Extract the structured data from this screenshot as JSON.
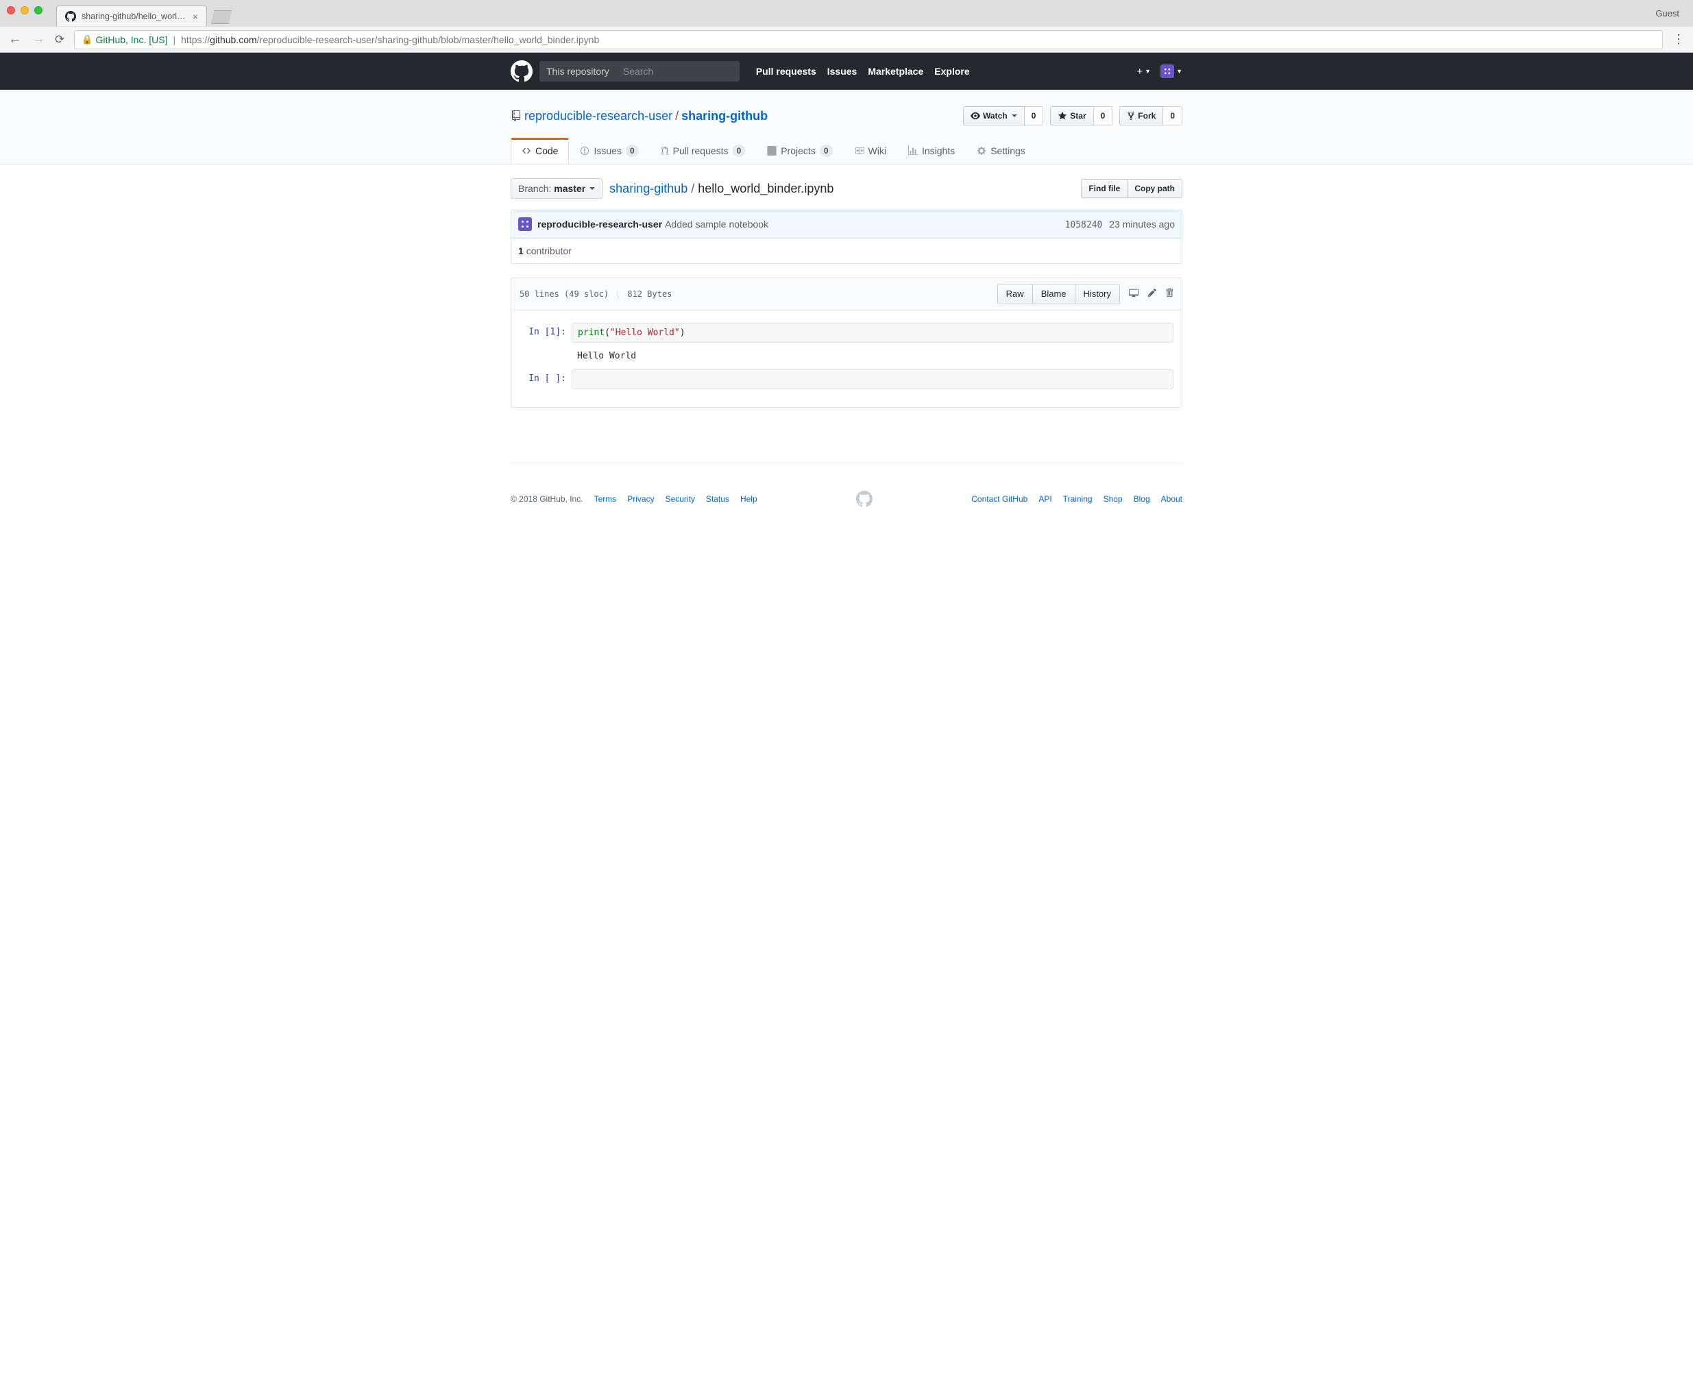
{
  "browser": {
    "tab_title": "sharing-github/hello_world_bin",
    "guest": "Guest",
    "url_identity": "GitHub, Inc. [US]",
    "url_prefix": "https://",
    "url_host": "github.com",
    "url_path": "/reproducible-research-user/sharing-github/blob/master/hello_world_binder.ipynb"
  },
  "header": {
    "scope": "This repository",
    "search_placeholder": "Search",
    "nav": {
      "pulls": "Pull requests",
      "issues": "Issues",
      "marketplace": "Marketplace",
      "explore": "Explore"
    }
  },
  "repo": {
    "owner": "reproducible-research-user",
    "name": "sharing-github",
    "watch_label": "Watch",
    "watch_count": "0",
    "star_label": "Star",
    "star_count": "0",
    "fork_label": "Fork",
    "fork_count": "0"
  },
  "tabs": {
    "code": "Code",
    "issues": "Issues",
    "issues_count": "0",
    "pulls": "Pull requests",
    "pulls_count": "0",
    "projects": "Projects",
    "projects_count": "0",
    "wiki": "Wiki",
    "insights": "Insights",
    "settings": "Settings"
  },
  "filebar": {
    "branch_label": "Branch:",
    "branch_name": "master",
    "crumb_repo": "sharing-github",
    "crumb_file": "hello_world_binder.ipynb",
    "find_file": "Find file",
    "copy_path": "Copy path"
  },
  "commit": {
    "author": "reproducible-research-user",
    "message": "Added sample notebook",
    "sha": "1058240",
    "time": "23 minutes ago"
  },
  "contributors": {
    "count": "1",
    "label": "contributor"
  },
  "file": {
    "lines": "50 lines (49 sloc)",
    "size": "812 Bytes",
    "raw": "Raw",
    "blame": "Blame",
    "history": "History"
  },
  "notebook": {
    "in1_prompt": "In [1]:",
    "in1_fn": "print",
    "in1_paren_open": "(",
    "in1_str": "\"Hello World\"",
    "in1_paren_close": ")",
    "out1": "Hello World",
    "in2_prompt": "In [ ]:"
  },
  "footer": {
    "copyright": "© 2018 GitHub, Inc.",
    "terms": "Terms",
    "privacy": "Privacy",
    "security": "Security",
    "status": "Status",
    "help": "Help",
    "contact": "Contact GitHub",
    "api": "API",
    "training": "Training",
    "shop": "Shop",
    "blog": "Blog",
    "about": "About"
  }
}
